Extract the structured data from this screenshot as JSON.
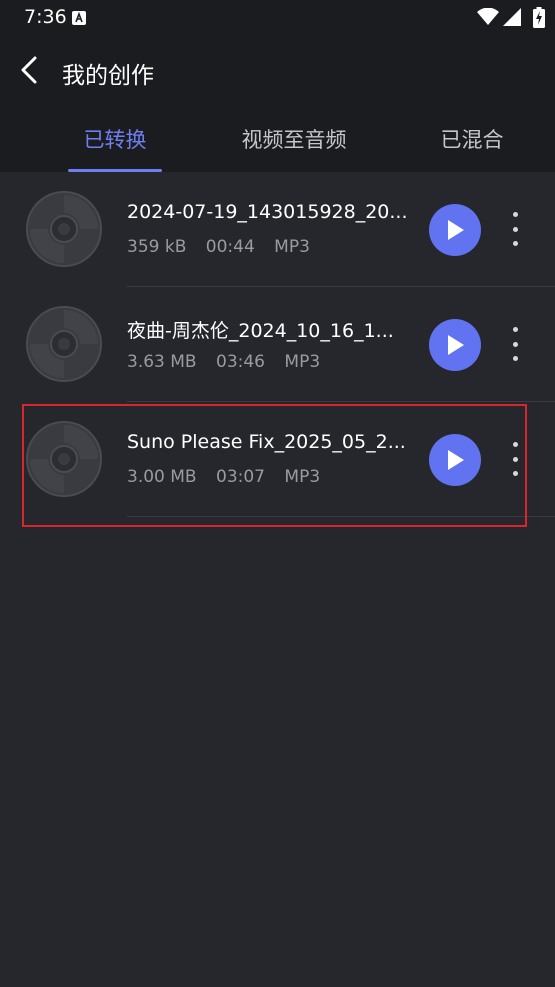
{
  "status_bar": {
    "time": "7:36",
    "icons": [
      "a-icon",
      "wifi-icon",
      "cell-signal-icon",
      "battery-charging-icon"
    ]
  },
  "header": {
    "title": "我的创作",
    "back_icon": "chevron-left-icon"
  },
  "tabs": [
    {
      "label": "已转换",
      "active": true
    },
    {
      "label": "视频至音频",
      "active": false
    },
    {
      "label": "已混合",
      "active": false
    }
  ],
  "files": [
    {
      "name": "2024-07-19_143015928_20...",
      "size": "359 kB",
      "duration": "00:44",
      "format": "MP3"
    },
    {
      "name": "夜曲-周杰伦_2024_10_16_1...",
      "size": "3.63 MB",
      "duration": "03:46",
      "format": "MP3"
    },
    {
      "name": "Suno Please Fix_2025_05_2...",
      "size": "3.00 MB",
      "duration": "03:07",
      "format": "MP3"
    }
  ],
  "colors": {
    "accent": "#6f7ff0",
    "play": "#6173f0",
    "highlight": "#d8262c",
    "background": "#26272c",
    "header": "#1b1c20"
  }
}
